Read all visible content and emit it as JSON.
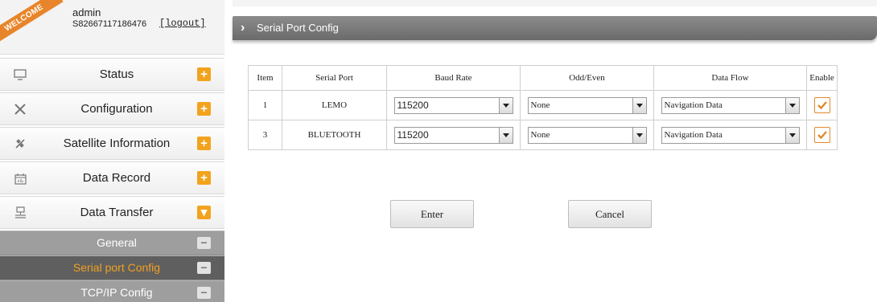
{
  "user": {
    "welcome_badge": "WELCOME",
    "name": "admin",
    "serial": "S82667117186476",
    "logout_label": "[logout]"
  },
  "menu": {
    "items": [
      {
        "label": "Status",
        "icon": "monitor-icon",
        "toggle": "+"
      },
      {
        "label": "Configuration",
        "icon": "tools-icon",
        "toggle": "+"
      },
      {
        "label": "Satellite Information",
        "icon": "satellite-icon",
        "toggle": "+"
      },
      {
        "label": "Data Record",
        "icon": "calendar-icon",
        "toggle": "+"
      },
      {
        "label": "Data Transfer",
        "icon": "network-icon",
        "toggle": "▾"
      }
    ],
    "subitems": [
      {
        "label": "General",
        "toggle": "−"
      },
      {
        "label": "Serial port Config",
        "toggle": "−",
        "active": true
      },
      {
        "label": "TCP/IP Config",
        "toggle": "−"
      }
    ]
  },
  "page": {
    "title": "Serial Port Config"
  },
  "table": {
    "headers": [
      "Item",
      "Serial Port",
      "Baud Rate",
      "Odd/Even",
      "Data Flow",
      "Enable"
    ],
    "rows": [
      {
        "item": "1",
        "port": "LEMO",
        "baud": "115200",
        "odd_even": "None",
        "data_flow": "Navigation Data",
        "enabled": true
      },
      {
        "item": "3",
        "port": "BLUETOOTH",
        "baud": "115200",
        "odd_even": "None",
        "data_flow": "Navigation Data",
        "enabled": true
      }
    ]
  },
  "buttons": {
    "enter": "Enter",
    "cancel": "Cancel"
  },
  "colors": {
    "accent_orange": "#f2a31d",
    "active_submenu_text": "#f0a020",
    "title_bar": "#7a7a7a"
  }
}
